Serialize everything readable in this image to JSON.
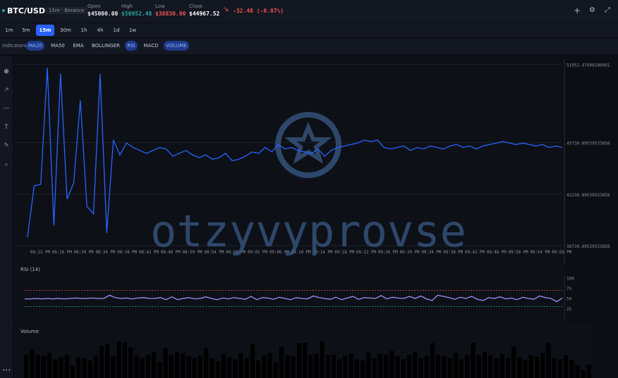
{
  "header": {
    "symbol": "BTC/USD",
    "badge": "15m · Binance",
    "open_label": "Open",
    "open_value": "$45000.00",
    "high_label": "High",
    "high_value": "$50952.48",
    "low_label": "Low",
    "low_value": "$38830.90",
    "close_label": "Close",
    "close_value": "$44967.52",
    "change": "-32.48 (-0.07%)",
    "trend_icon": "↘"
  },
  "intervals": [
    "1m",
    "5m",
    "15m",
    "30m",
    "1h",
    "4h",
    "1d",
    "1w"
  ],
  "active_interval": "15m",
  "indicators": {
    "label": "Indicators:",
    "items": [
      {
        "name": "MA20",
        "active": true
      },
      {
        "name": "MA50",
        "active": false
      },
      {
        "name": "EMA",
        "active": false
      },
      {
        "name": "BOLLINGER",
        "active": false
      },
      {
        "name": "RSI",
        "active": true
      },
      {
        "name": "MACD",
        "active": false
      },
      {
        "name": "VOLUME",
        "active": true
      }
    ]
  },
  "watermark": "otzyvyprovse",
  "colors": {
    "up": "#26a69a",
    "down": "#ef5350",
    "line": "#2962ff",
    "rsi": "#a78bfa",
    "accent": "#2962ff"
  },
  "chart_data": [
    {
      "type": "line",
      "title": "",
      "y_ticks": [
        "51052.47998286691",
        "45730.89539533858",
        "42230.89539533858",
        "38730.89539533858"
      ],
      "x": [
        "08:22 PM",
        "08:26 PM",
        "08:30 PM",
        "08:34 PM",
        "08:38 PM",
        "08:42 PM",
        "08:46 PM",
        "08:50 PM",
        "08:54 PM",
        "08:58 PM",
        "09:02 PM",
        "09:06 PM",
        "09:10 PM",
        "09:14 PM",
        "09:18 PM",
        "09:22 PM",
        "09:26 PM",
        "09:30 PM",
        "09:34 PM",
        "09:38 PM",
        "09:42 PM",
        "09:46 PM",
        "09:50 PM",
        "09:54 PM",
        "09:58 PM"
      ],
      "ylim": [
        38300,
        51400
      ],
      "values": [
        39300,
        42800,
        42900,
        50800,
        40100,
        50400,
        41900,
        43000,
        48600,
        41400,
        40900,
        50400,
        39600,
        45900,
        44900,
        45700,
        45400,
        45200,
        45000,
        45200,
        45400,
        45300,
        44800,
        45000,
        45200,
        44900,
        44700,
        44900,
        44600,
        44700,
        45000,
        44500,
        44600,
        44800,
        45100,
        45000,
        45400,
        45100,
        45600,
        45300,
        45400,
        45200,
        45100,
        45000,
        45300,
        44800,
        45200,
        45400,
        45500,
        45600,
        45700,
        45900,
        45800,
        45900,
        45400,
        45300,
        45400,
        45500,
        45200,
        45400,
        45300,
        45500,
        45400,
        45300,
        45500,
        45600,
        45400,
        45500,
        45300,
        45500,
        45600,
        45700,
        45800,
        45700,
        45600,
        45700,
        45600,
        45500,
        45600,
        45400,
        45500,
        45400
      ]
    },
    {
      "type": "line",
      "title": "RSI (14)",
      "y_ticks": [
        "100",
        "75",
        "50",
        "25"
      ],
      "ylim": [
        0,
        100
      ],
      "overbought": 70,
      "oversold": 30,
      "values": [
        49,
        49,
        50,
        49,
        50,
        49,
        50,
        49,
        50,
        51,
        50,
        50,
        51,
        50,
        50,
        58,
        52,
        50,
        51,
        49,
        51,
        52,
        50,
        50,
        52,
        47,
        54,
        47,
        50,
        52,
        49,
        50,
        54,
        50,
        47,
        51,
        49,
        52,
        50,
        48,
        55,
        47,
        52,
        51,
        48,
        53,
        50,
        47,
        52,
        50,
        49,
        56,
        52,
        50,
        48,
        53,
        47,
        51,
        55,
        48,
        52,
        51,
        50,
        57,
        49,
        53,
        51,
        50,
        55,
        50,
        56,
        49,
        45,
        58,
        55,
        52,
        48,
        53,
        50,
        55,
        48,
        45,
        52,
        50,
        54,
        49,
        51,
        47,
        53,
        50,
        48,
        56,
        52,
        50,
        42,
        51
      ]
    },
    {
      "type": "bar",
      "title": "Volume",
      "ylim": [
        0,
        100
      ],
      "values": [
        55,
        70,
        55,
        52,
        60,
        45,
        50,
        55,
        30,
        50,
        48,
        42,
        55,
        78,
        82,
        52,
        88,
        86,
        74,
        55,
        48,
        55,
        62,
        38,
        72,
        55,
        62,
        60,
        52,
        48,
        55,
        72,
        48,
        40,
        58,
        50,
        45,
        60,
        48,
        82,
        42,
        55,
        60,
        38,
        75,
        55,
        52,
        84,
        85,
        55,
        58,
        88,
        56,
        56,
        45,
        54,
        58,
        45,
        42,
        62,
        48,
        58,
        55,
        65,
        52,
        45,
        55,
        64,
        48,
        54,
        84,
        55,
        52,
        48,
        60,
        44,
        55,
        85,
        55,
        62,
        55,
        48,
        58,
        48,
        76,
        50,
        44,
        55,
        52,
        60,
        85,
        48,
        45,
        55,
        44,
        32,
        20,
        32
      ]
    }
  ]
}
